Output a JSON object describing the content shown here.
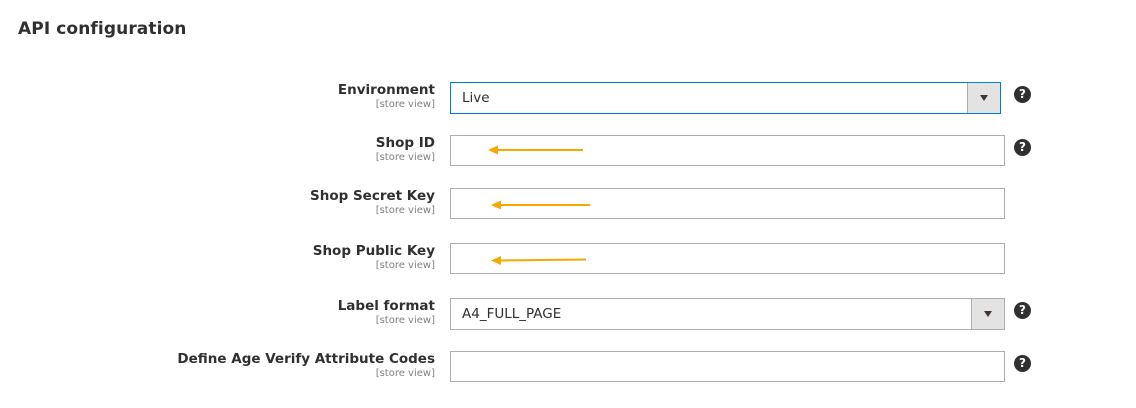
{
  "section": {
    "title": "API configuration"
  },
  "fields": [
    {
      "id": "environment",
      "label": "Environment",
      "scope": "[store view]",
      "type": "select",
      "value": "Live",
      "help": "?"
    },
    {
      "id": "shop_id",
      "label": "Shop ID",
      "scope": "[store view]",
      "type": "text",
      "value": "",
      "help": "?"
    },
    {
      "id": "shop_secret_key",
      "label": "Shop Secret Key",
      "scope": "[store view]",
      "type": "text",
      "value": ""
    },
    {
      "id": "shop_public_key",
      "label": "Shop Public Key",
      "scope": "[store view]",
      "type": "text",
      "value": ""
    },
    {
      "id": "label_format",
      "label": "Label format",
      "scope": "[store view]",
      "type": "select",
      "value": "A4_FULL_PAGE",
      "help": "?"
    },
    {
      "id": "age_verify_codes",
      "label": "Define Age Verify Attribute Codes",
      "scope": "[store view]",
      "type": "text",
      "value": "",
      "help": "?"
    }
  ],
  "colors": {
    "annotation_arrow": "#f5a800",
    "focus_border": "#007bdb",
    "input_border": "#adadad"
  },
  "icons": {
    "help": "question-circle-icon",
    "dropdown": "caret-down-icon",
    "annotation": "arrow-left-icon"
  }
}
